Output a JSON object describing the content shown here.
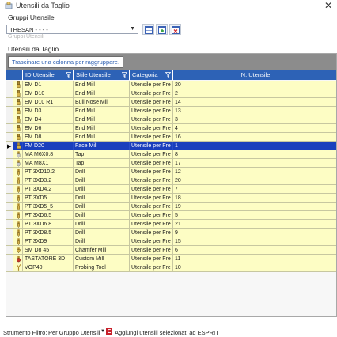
{
  "window": {
    "title": "Utensili da Taglio",
    "close_glyph": "✕"
  },
  "group": {
    "label": "Gruppi Utensile",
    "selected": "THESAN - - - -",
    "hidden_label": "Gruppi Utensili"
  },
  "section_label": "Utensili da Taglio",
  "grid": {
    "group_hint": "Trascinare una colonna per raggruppare.",
    "columns": [
      "ID Utensile",
      "Stile Utensile",
      "Categoria",
      "N. Utensile"
    ],
    "rows": [
      {
        "id": "EM D1",
        "style": "End Mill",
        "cat": "Utensile per Fre",
        "n": "20",
        "icon": "endmill-icon"
      },
      {
        "id": "EM D10",
        "style": "End Mill",
        "cat": "Utensile per Fre",
        "n": "2",
        "icon": "endmill-icon"
      },
      {
        "id": "EM D10 R1",
        "style": "Bull Nose Mill",
        "cat": "Utensile per Fre",
        "n": "14",
        "icon": "endmill-icon"
      },
      {
        "id": "EM D3",
        "style": "End Mill",
        "cat": "Utensile per Fre",
        "n": "13",
        "icon": "endmill-icon"
      },
      {
        "id": "EM D4",
        "style": "End Mill",
        "cat": "Utensile per Fre",
        "n": "3",
        "icon": "endmill-icon"
      },
      {
        "id": "EM D6",
        "style": "End Mill",
        "cat": "Utensile per Fre",
        "n": "4",
        "icon": "endmill-icon"
      },
      {
        "id": "EM D8",
        "style": "End Mill",
        "cat": "Utensile per Fre",
        "n": "16",
        "icon": "endmill-icon"
      },
      {
        "id": "FM D20",
        "style": "Face Mill",
        "cat": "Utensile per Fre",
        "n": "1",
        "icon": "facemill-icon",
        "selected": true
      },
      {
        "id": "MA M6X0.8",
        "style": "Tap",
        "cat": "Utensile per Fre",
        "n": "8",
        "icon": "tap-icon"
      },
      {
        "id": "MA M8X1",
        "style": "Tap",
        "cat": "Utensile per Fre",
        "n": "17",
        "icon": "tap-icon"
      },
      {
        "id": "PT 3XD10.2",
        "style": "Drill",
        "cat": "Utensile per Fre",
        "n": "12",
        "icon": "drill-icon"
      },
      {
        "id": "PT 3XD3.2",
        "style": "Drill",
        "cat": "Utensile per Fre",
        "n": "20",
        "icon": "drill-icon"
      },
      {
        "id": "PT 3XD4.2",
        "style": "Drill",
        "cat": "Utensile per Fre",
        "n": "7",
        "icon": "drill-icon"
      },
      {
        "id": "PT 3XD5",
        "style": "Drill",
        "cat": "Utensile per Fre",
        "n": "18",
        "icon": "drill-icon"
      },
      {
        "id": "PT 3XD5_5",
        "style": "Drill",
        "cat": "Utensile per Fre",
        "n": "19",
        "icon": "drill-icon"
      },
      {
        "id": "PT 3XD6.5",
        "style": "Drill",
        "cat": "Utensile per Fre",
        "n": "5",
        "icon": "drill-icon"
      },
      {
        "id": "PT 3XD6.8",
        "style": "Drill",
        "cat": "Utensile per Fre",
        "n": "21",
        "icon": "drill-icon"
      },
      {
        "id": "PT 3XD8.5",
        "style": "Drill",
        "cat": "Utensile per Fre",
        "n": "9",
        "icon": "drill-icon"
      },
      {
        "id": "PT 3XD9",
        "style": "Drill",
        "cat": "Utensile per Fre",
        "n": "15",
        "icon": "drill-icon"
      },
      {
        "id": "SM D8 45",
        "style": "Chamfer Mill",
        "cat": "Utensile per Fre",
        "n": "6",
        "icon": "chamfer-mill-icon"
      },
      {
        "id": "TASTATORE 3D",
        "style": "Custom Mill",
        "cat": "Utensile per Fre",
        "n": "11",
        "icon": "custom-mill-icon"
      },
      {
        "id": "VOP40",
        "style": "Probing Tool",
        "cat": "Utensile per Fre",
        "n": "10",
        "icon": "probe-icon"
      }
    ]
  },
  "status": {
    "filter_label": "Strumento Filtro:",
    "filter_value": "Per Gruppo Utensili",
    "dropdown_glyph": "▼",
    "esprit_icon_letter": "E",
    "add_button": "Aggiungi utensili selezionati ad ESPRIT"
  },
  "colors": {
    "row_bg": "#fdfdc4",
    "selected_bg": "#1a3fbd",
    "header_bg": "#2d62b6",
    "group_area_bg": "#8c8c8c"
  }
}
